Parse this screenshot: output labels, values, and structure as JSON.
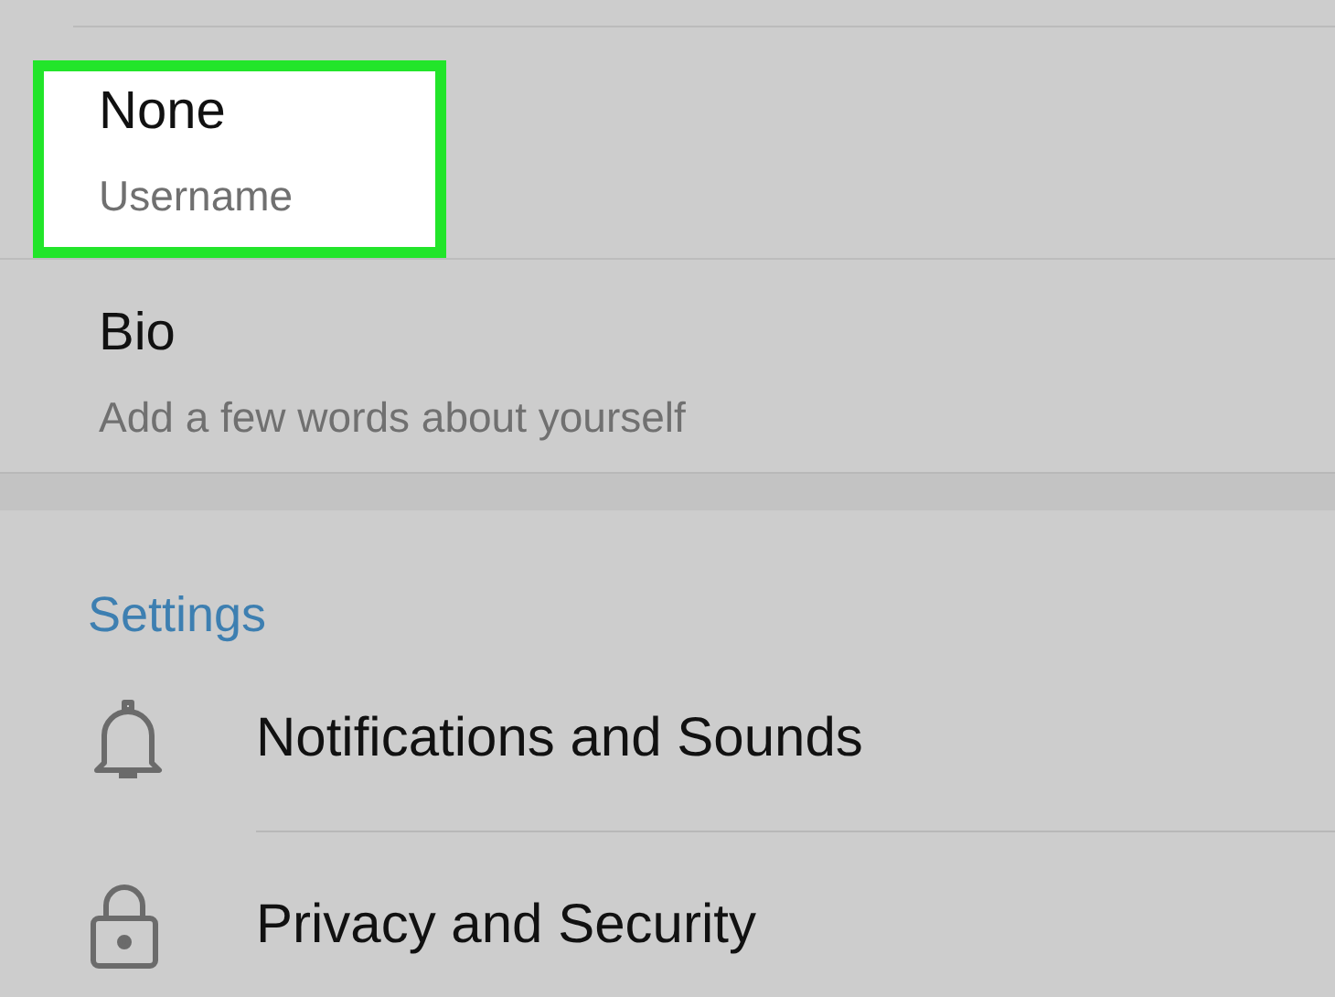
{
  "account": [
    {
      "value": "None",
      "label": "Username",
      "highlighted": true
    },
    {
      "value": "Bio",
      "label": "Add a few words about yourself",
      "highlighted": false
    }
  ],
  "settings": {
    "header": "Settings",
    "items": [
      {
        "kind": "bell",
        "label": "Notifications and Sounds"
      },
      {
        "kind": "lock",
        "label": "Privacy and Security"
      }
    ]
  }
}
